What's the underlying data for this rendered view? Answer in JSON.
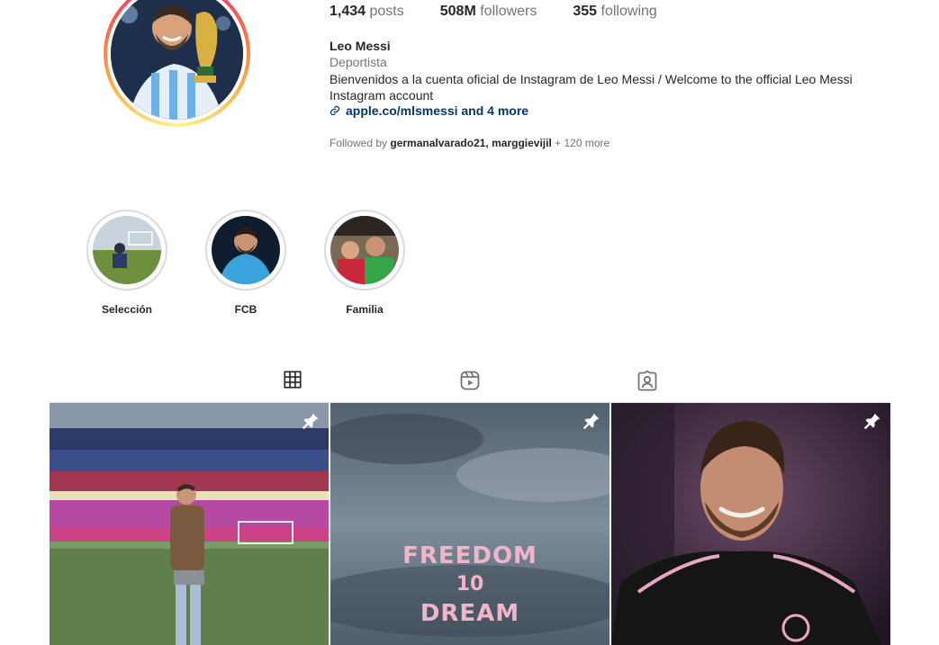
{
  "profile": {
    "stats": [
      {
        "count": "1,434",
        "label": "posts"
      },
      {
        "count": "508M",
        "label": "followers"
      },
      {
        "count": "355",
        "label": "following"
      }
    ],
    "name": "Leo Messi",
    "category": "Deportista",
    "bio": "Bienvenidos a la cuenta oficial de Instagram de Leo Messi / Welcome to the official Leo Messi Instagram account",
    "link": "apple.co/mlsmessi and 4 more",
    "followed_by": {
      "prefix": "Followed by",
      "users": "germanalvarado21, marggievijil",
      "more": "+ 120 more"
    }
  },
  "highlights": [
    {
      "label": "Selección"
    },
    {
      "label": "FCB"
    },
    {
      "label": "Familia"
    }
  ],
  "tabs": [
    {
      "icon": "grid-icon",
      "active": true
    },
    {
      "icon": "reels-icon",
      "active": false
    },
    {
      "icon": "tagged-icon",
      "active": false
    }
  ],
  "posts": [
    {
      "pinned": true,
      "icon": "pin-icon"
    },
    {
      "pinned": true,
      "icon": "pin-icon",
      "overlay_text": [
        "FREEDOM",
        "10",
        "DREAM"
      ]
    },
    {
      "pinned": true,
      "icon": "pin-icon"
    }
  ]
}
